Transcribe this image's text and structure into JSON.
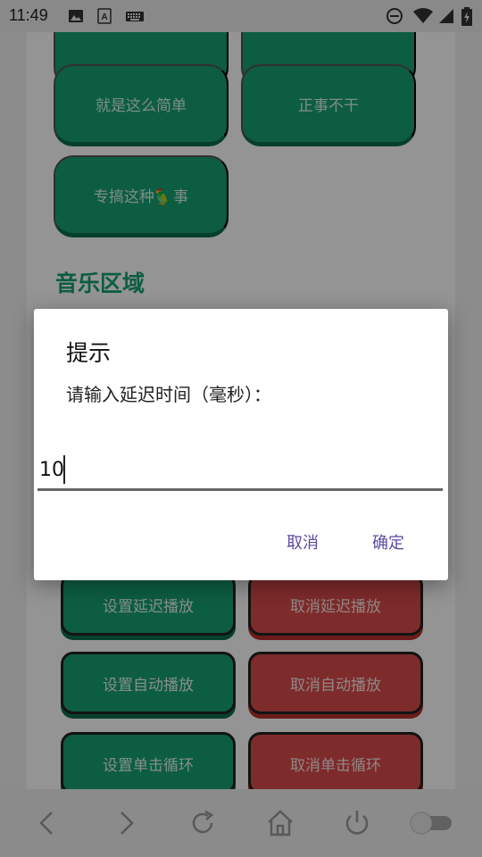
{
  "status_bar": {
    "time": "11:49",
    "icons": [
      "image-icon",
      "font-a-icon",
      "keyboard-icon",
      "do-not-disturb-icon",
      "wifi-icon",
      "signal-icon",
      "battery-charging-icon"
    ]
  },
  "page": {
    "top_buttons": [
      {
        "label": ""
      },
      {
        "label": ""
      },
      {
        "label": "就是这么简单"
      },
      {
        "label": "正事不干"
      },
      {
        "label": "专搞这种🦜事"
      }
    ],
    "section_title": "音乐区域",
    "controls": [
      {
        "label": "设置延迟播放",
        "color": "green"
      },
      {
        "label": "取消延迟播放",
        "color": "red"
      },
      {
        "label": "设置自动播放",
        "color": "green"
      },
      {
        "label": "取消自动播放",
        "color": "red"
      },
      {
        "label": "设置单击循环",
        "color": "green"
      },
      {
        "label": "取消单击循环",
        "color": "red"
      }
    ]
  },
  "dialog": {
    "title": "提示",
    "message": "请输入延迟时间（毫秒）：",
    "input_value": "10",
    "cancel_label": "取消",
    "confirm_label": "确定"
  },
  "bottom_nav": {
    "icons": [
      "back-arrow-icon",
      "forward-arrow-icon",
      "refresh-icon",
      "home-icon",
      "power-icon",
      "toggle-switch-icon"
    ]
  },
  "colors": {
    "brand_green": "#17a073",
    "danger_red": "#d94a4a",
    "dialog_button": "#5c4aa0"
  }
}
